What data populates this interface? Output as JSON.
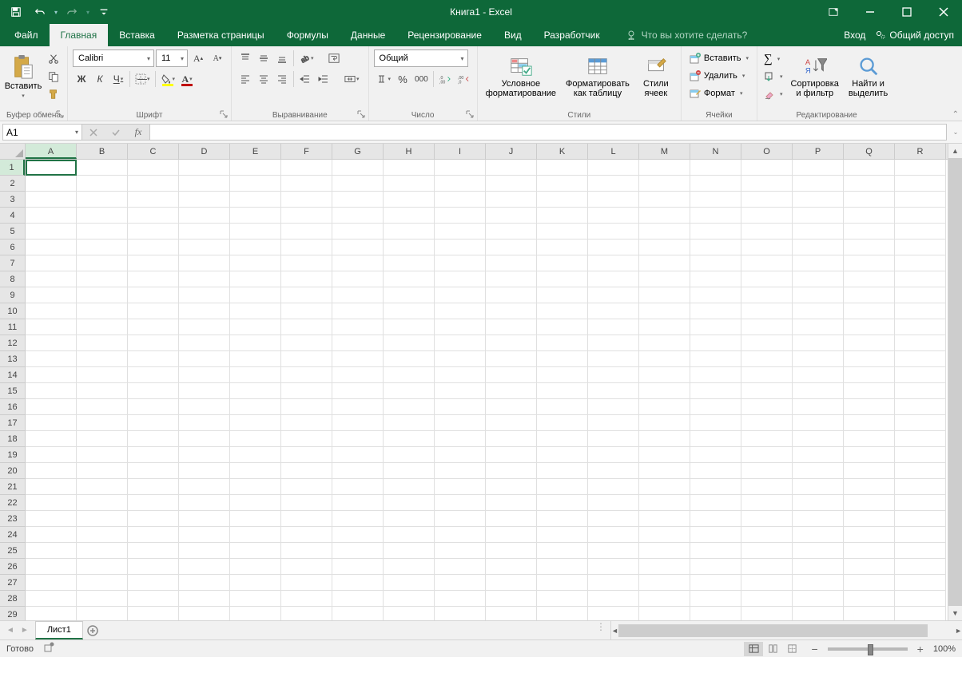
{
  "title": "Книга1 - Excel",
  "qat": {
    "save": "save-icon",
    "undo": "undo-icon",
    "redo": "redo-icon",
    "customize": "customize-icon"
  },
  "window": {
    "ribbon_opts": "ribbon-options-icon",
    "min": "minimize-icon",
    "max": "maximize-icon",
    "close": "close-icon"
  },
  "tabs": {
    "file": "Файл",
    "home": "Главная",
    "insert": "Вставка",
    "page_layout": "Разметка страницы",
    "formulas": "Формулы",
    "data": "Данные",
    "review": "Рецензирование",
    "view": "Вид",
    "developer": "Разработчик"
  },
  "tell_me": "Что вы хотите сделать?",
  "signin": "Вход",
  "share": "Общий доступ",
  "ribbon": {
    "clipboard": {
      "label": "Буфер обмена",
      "paste": "Вставить"
    },
    "font": {
      "label": "Шрифт",
      "name": "Calibri",
      "size": "11",
      "bold": "Ж",
      "italic": "К",
      "underline": "Ч"
    },
    "alignment": {
      "label": "Выравнивание"
    },
    "number": {
      "label": "Число",
      "format": "Общий"
    },
    "styles": {
      "label": "Стили",
      "cond": "Условное\nформатирование",
      "table": "Форматировать\nкак таблицу",
      "cell": "Стили\nячеек"
    },
    "cells": {
      "label": "Ячейки",
      "insert": "Вставить",
      "delete": "Удалить",
      "format": "Формат"
    },
    "editing": {
      "label": "Редактирование",
      "sort": "Сортировка\nи фильтр",
      "find": "Найти и\nвыделить"
    }
  },
  "namebox": "A1",
  "columns": [
    "A",
    "B",
    "C",
    "D",
    "E",
    "F",
    "G",
    "H",
    "I",
    "J",
    "K",
    "L",
    "M",
    "N",
    "O",
    "P",
    "Q",
    "R"
  ],
  "rows": [
    1,
    2,
    3,
    4,
    5,
    6,
    7,
    8,
    9,
    10,
    11,
    12,
    13,
    14,
    15,
    16,
    17,
    18,
    19,
    20,
    21,
    22,
    23,
    24,
    25,
    26,
    27,
    28,
    29
  ],
  "active_cell": "A1",
  "sheet": {
    "tab": "Лист1"
  },
  "status": {
    "ready": "Готово",
    "zoom": "100%"
  }
}
